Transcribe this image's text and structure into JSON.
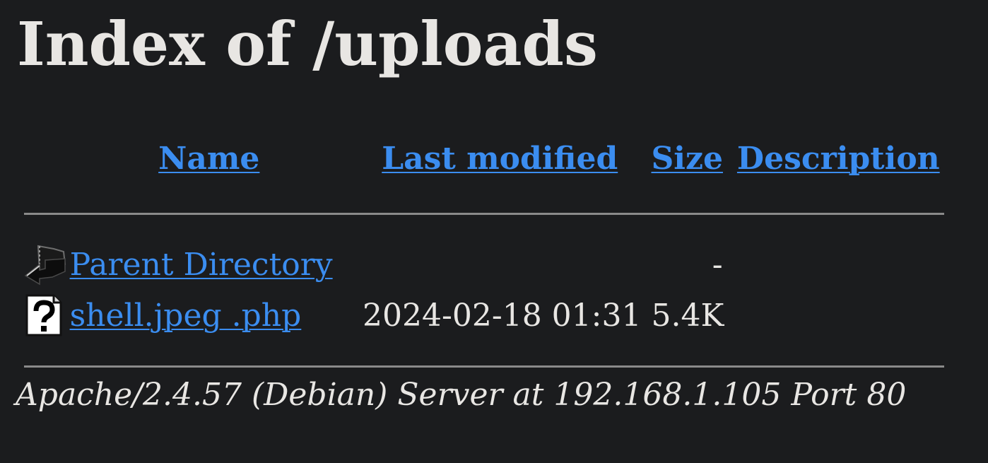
{
  "page": {
    "title": "Index of /uploads"
  },
  "table": {
    "headers": {
      "name": "Name",
      "last_modified": "Last modified",
      "size": "Size",
      "description": "Description"
    },
    "rows": [
      {
        "icon": "back-arrow-icon",
        "name": "Parent Directory",
        "last_modified": "",
        "size": "-",
        "description": ""
      },
      {
        "icon": "unknown-file-icon",
        "name": "shell.jpeg .php",
        "last_modified": "2024-02-18 01:31",
        "size": "5.4K",
        "description": ""
      }
    ]
  },
  "footer": {
    "address": "Apache/2.4.57 (Debian) Server at 192.168.1.105 Port 80"
  },
  "colors": {
    "background": "#1b1c1e",
    "text": "#e8e6e3",
    "link": "#3b8df0",
    "rule": "#8a8a8a"
  }
}
